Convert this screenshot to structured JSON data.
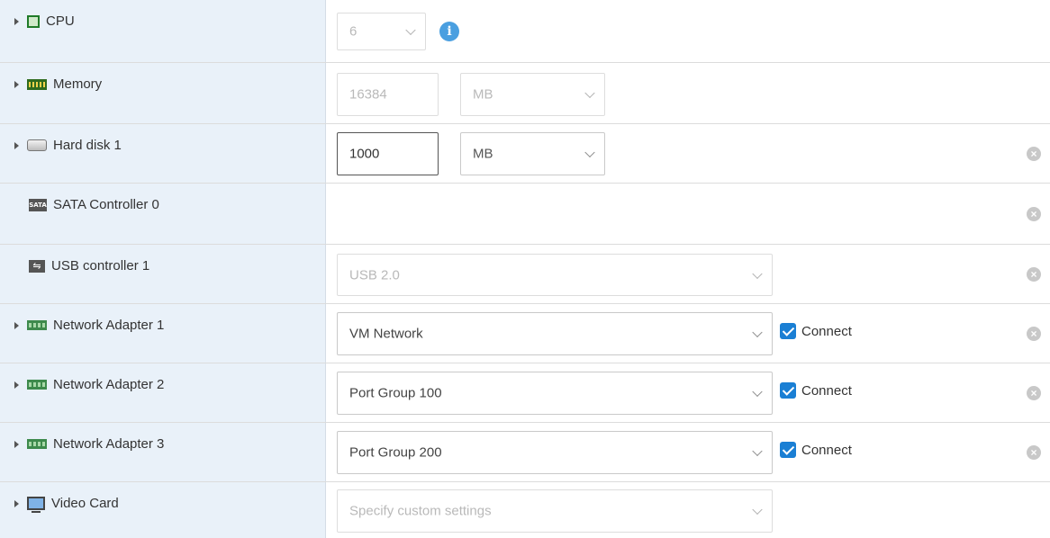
{
  "rows": {
    "cpu": {
      "label": "CPU",
      "icon": "cpu-icon",
      "expandable": true,
      "select_value": "6",
      "info_icon": "info-icon"
    },
    "memory": {
      "label": "Memory",
      "icon": "memory-icon",
      "expandable": true,
      "value": "16384",
      "unit": "MB"
    },
    "hard_disk": {
      "label": "Hard disk 1",
      "icon": "hard-disk-icon",
      "expandable": true,
      "value": "1000",
      "unit": "MB",
      "removable": true
    },
    "sata": {
      "label": "SATA Controller 0",
      "icon": "sata-icon",
      "icon_text": "SATA",
      "expandable": false,
      "removable": true
    },
    "usb": {
      "label": "USB controller 1",
      "icon": "usb-icon",
      "expandable": false,
      "select_value": "USB 2.0",
      "removable": true
    },
    "net1": {
      "label": "Network Adapter 1",
      "icon": "network-adapter-icon",
      "expandable": true,
      "select_value": "VM Network",
      "connect_label": "Connect",
      "connected": true,
      "removable": true
    },
    "net2": {
      "label": "Network Adapter 2",
      "icon": "network-adapter-icon",
      "expandable": true,
      "select_value": "Port Group 100",
      "connect_label": "Connect",
      "connected": true,
      "removable": true
    },
    "net3": {
      "label": "Network Adapter 3",
      "icon": "network-adapter-icon",
      "expandable": true,
      "select_value": "Port Group 200",
      "connect_label": "Connect",
      "connected": true,
      "removable": true
    },
    "video": {
      "label": "Video Card",
      "icon": "video-card-icon",
      "expandable": true,
      "select_value": "Specify custom settings"
    }
  },
  "colors": {
    "label_bg": "#e9f1f9",
    "accent": "#1a7fd4",
    "info": "#4a9fe0",
    "remove": "#c8c8c8"
  }
}
